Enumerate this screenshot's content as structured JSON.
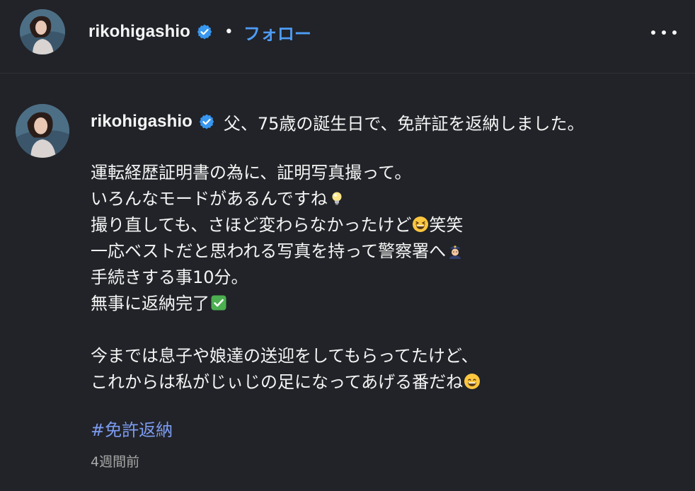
{
  "header": {
    "username": "rikohigashio",
    "separator": "•",
    "follow_label": "フォロー",
    "more_icon": "more-horizontal-icon"
  },
  "comment": {
    "username": "rikohigashio",
    "first_line": "父、75歳の誕生日で、免許証を返納しました。",
    "lines": [
      {
        "text": "運転経歴証明書の為に、証明写真撮って。",
        "emoji": ""
      },
      {
        "text": "いろんなモードがあるんですね",
        "emoji": "light-bulb"
      },
      {
        "text": "撮り直しても、さほど変わらなかったけど",
        "emoji": "grinning-squinting",
        "after": "笑笑"
      },
      {
        "text": "一応ベストだと思われる写真を持って警察署へ",
        "emoji": "police-officer"
      },
      {
        "text": "手続きする事10分。",
        "emoji": ""
      },
      {
        "text": "無事に返納完了",
        "emoji": "check-mark-button"
      }
    ],
    "lines2": [
      {
        "text": "今までは息子や娘達の送迎をしてもらってたけど、",
        "emoji": ""
      },
      {
        "text": "これからは私がじぃじの足になってあげる番だね",
        "emoji": "grinning-face"
      }
    ],
    "hashtag": "#免許返納",
    "timestamp": "4週間前"
  },
  "colors": {
    "background": "#212328",
    "text": "#f5f5f5",
    "follow": "#4e9cf5",
    "hashtag": "#7c9bf0",
    "muted": "#a8a8a8",
    "verified": "#3897f0"
  }
}
